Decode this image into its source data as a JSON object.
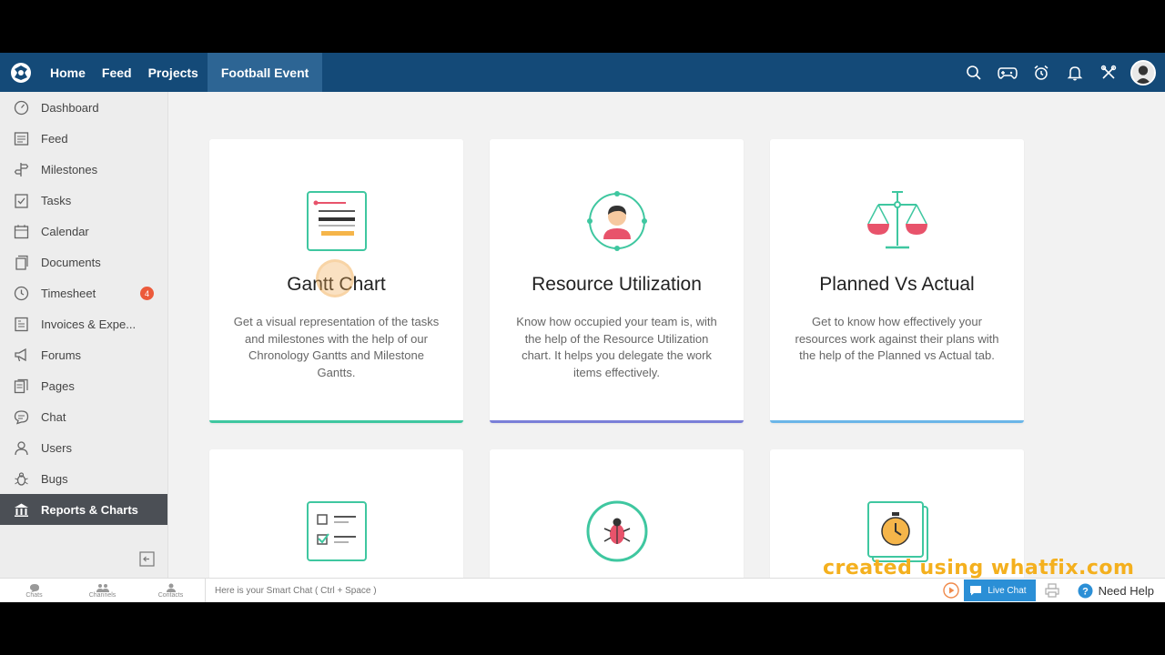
{
  "nav": {
    "items": [
      {
        "label": "Home"
      },
      {
        "label": "Feed"
      },
      {
        "label": "Projects"
      },
      {
        "label": "Football Event"
      }
    ]
  },
  "sidebar": {
    "items": [
      {
        "label": "Dashboard",
        "icon": "dashboard-icon"
      },
      {
        "label": "Feed",
        "icon": "feed-icon"
      },
      {
        "label": "Milestones",
        "icon": "milestone-icon"
      },
      {
        "label": "Tasks",
        "icon": "tasks-icon"
      },
      {
        "label": "Calendar",
        "icon": "calendar-icon"
      },
      {
        "label": "Documents",
        "icon": "documents-icon"
      },
      {
        "label": "Timesheet",
        "icon": "clock-icon",
        "badge": "4"
      },
      {
        "label": "Invoices & Expe...",
        "icon": "invoice-icon"
      },
      {
        "label": "Forums",
        "icon": "megaphone-icon"
      },
      {
        "label": "Pages",
        "icon": "pages-icon"
      },
      {
        "label": "Chat",
        "icon": "chat-icon"
      },
      {
        "label": "Users",
        "icon": "users-icon"
      },
      {
        "label": "Bugs",
        "icon": "bug-icon"
      },
      {
        "label": "Reports & Charts",
        "icon": "bank-icon"
      }
    ]
  },
  "cards": [
    {
      "title": "Gantt Chart",
      "desc": "Get a visual representation of the tasks and milestones with the help of our Chronology Gantts and Milestone Gantts.",
      "bar_color": "#3fc7a0"
    },
    {
      "title": "Resource Utilization",
      "desc": "Know how occupied your team is, with the help of the Resource Utilization chart. It helps you delegate the work items effectively.",
      "bar_color": "#7a7fd8"
    },
    {
      "title": "Planned Vs Actual",
      "desc": "Get to know how effectively your resources work against their plans with the help of the Planned vs Actual tab.",
      "bar_color": "#6bb6e8"
    },
    {
      "title": "",
      "desc": ""
    },
    {
      "title": "",
      "desc": ""
    },
    {
      "title": "",
      "desc": ""
    }
  ],
  "bottombar": {
    "tabs": [
      {
        "label": "Chats"
      },
      {
        "label": "Channels"
      },
      {
        "label": "Contacts"
      }
    ],
    "smart_chat_placeholder": "Here is your Smart Chat ( Ctrl + Space )",
    "live_chat": "Live Chat",
    "need_help": "Need Help"
  },
  "watermark": "created using whatfix.com"
}
